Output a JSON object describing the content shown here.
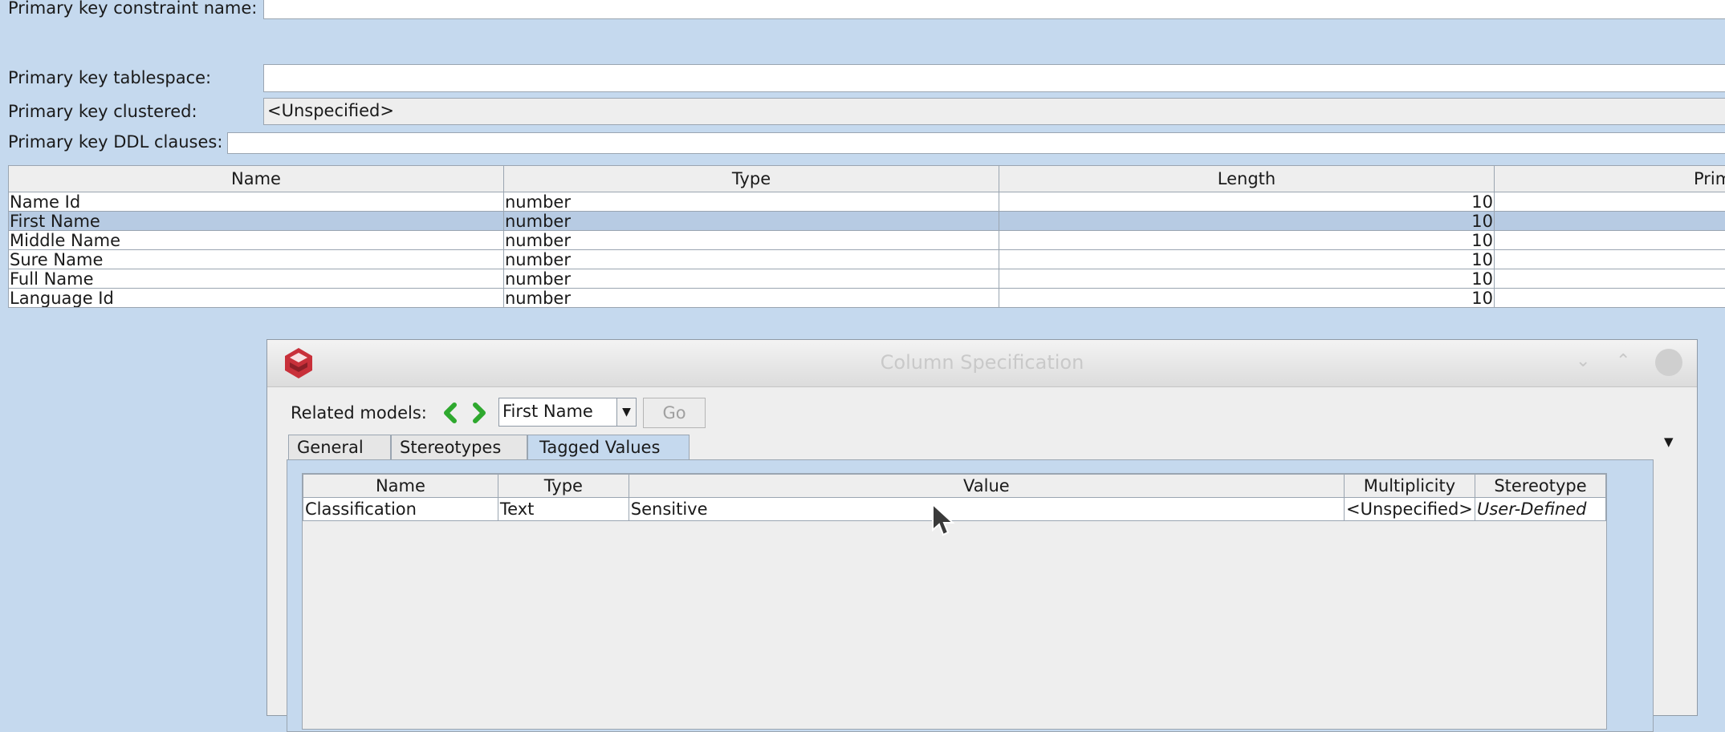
{
  "form": {
    "pk_constraint_label": "Primary key constraint name:",
    "pk_constraint_value": "",
    "pk_tablespace_label": "Primary key tablespace:",
    "pk_tablespace_value": "",
    "pk_clustered_label": "Primary key clustered:",
    "pk_clustered_value": "<Unspecified>",
    "pk_ddl_label": "Primary key DDL clauses:",
    "pk_ddl_value": ""
  },
  "columns_table": {
    "headers": [
      "Name",
      "Type",
      "Length",
      "Prim"
    ],
    "rows": [
      {
        "name": "Name Id",
        "type": "number",
        "length": "10",
        "selected": false
      },
      {
        "name": "First Name",
        "type": "number",
        "length": "10",
        "selected": true
      },
      {
        "name": "Middle Name",
        "type": "number",
        "length": "10",
        "selected": false
      },
      {
        "name": "Sure Name",
        "type": "number",
        "length": "10",
        "selected": false
      },
      {
        "name": "Full Name",
        "type": "number",
        "length": "10",
        "selected": false
      },
      {
        "name": "Language Id",
        "type": "number",
        "length": "10",
        "selected": false
      }
    ]
  },
  "dialog": {
    "title": "Column Specification",
    "related_models_label": "Related models:",
    "related_models_selected": "First Name",
    "go_label": "Go",
    "tabs": [
      "General",
      "Stereotypes",
      "Tagged Values"
    ],
    "active_tab": "Tagged Values",
    "tagged_values": {
      "headers": [
        "Name",
        "Type",
        "Value",
        "Multiplicity",
        "Stereotype"
      ],
      "rows": [
        {
          "name": "Classification",
          "type": "Text",
          "value": "Sensitive",
          "multiplicity": "<Unspecified>",
          "stereotype": "User-Defined"
        }
      ]
    }
  },
  "colors": {
    "background": "#c5d9ee",
    "selected_row": "#b7cbe3",
    "nav_arrow": "#2ea82e",
    "app_logo": "#c8303a"
  },
  "icons": [
    "app-logo-icon",
    "back-arrow-icon",
    "forward-arrow-icon",
    "dropdown-arrow-icon",
    "minimize-icon",
    "maximize-icon",
    "close-icon",
    "tab-menu-icon",
    "mouse-cursor-icon"
  ]
}
